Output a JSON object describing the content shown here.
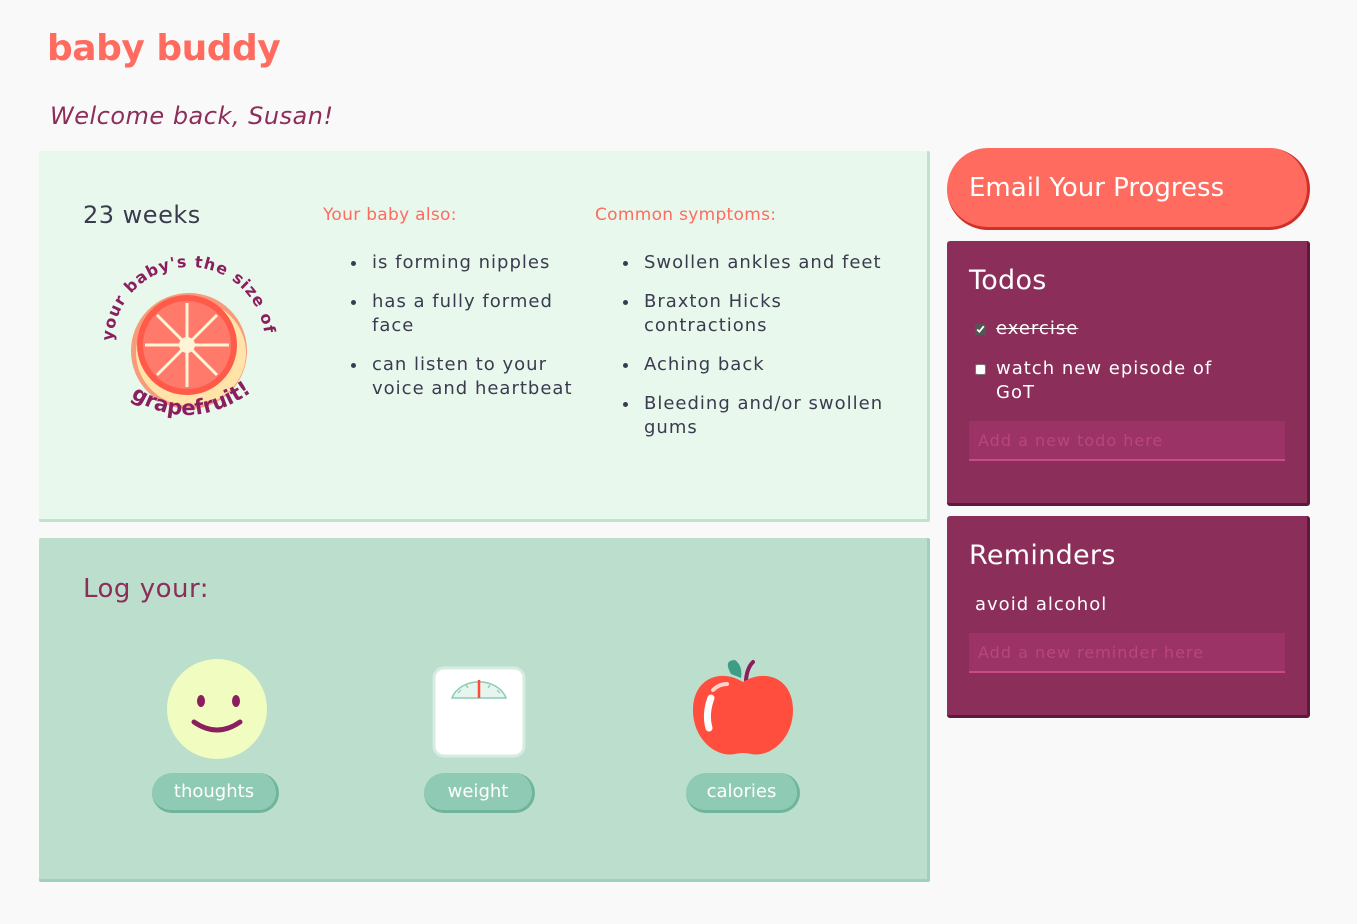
{
  "app": {
    "logo": "baby buddy",
    "welcome": "Welcome back, Susan!"
  },
  "week": {
    "weeks_label": "23 weeks",
    "badge_text_top": "your baby's the size of a",
    "badge_text_bottom": "grapefruit!",
    "baby_heading": "Your baby also:",
    "baby_items": [
      "is forming nipples",
      "has a fully formed face",
      "can listen to your voice and heartbeat"
    ],
    "symptoms_heading": "Common symptoms:",
    "symptom_items": [
      "Swollen ankles and feet",
      "Braxton Hicks contractions",
      "Aching back",
      "Bleeding and/or swollen gums"
    ]
  },
  "log": {
    "title": "Log your:",
    "thoughts_label": "thoughts",
    "weight_label": "weight",
    "calories_label": "calories"
  },
  "email": {
    "label": "Email Your Progress"
  },
  "todos": {
    "title": "Todos",
    "items": [
      {
        "text": "exercise",
        "done": true
      },
      {
        "text": "watch new episode of GoT",
        "done": false
      }
    ],
    "placeholder": "Add a new todo here"
  },
  "reminders": {
    "title": "Reminders",
    "items": [
      "avoid alcohol"
    ],
    "placeholder": "Add a new reminder here"
  },
  "colors": {
    "coral": "#ff6b5e",
    "plum": "#8b2e5a",
    "mint": "#e8f8ec",
    "sage": "#bcdecd",
    "teal_button": "#8fcbb4"
  }
}
